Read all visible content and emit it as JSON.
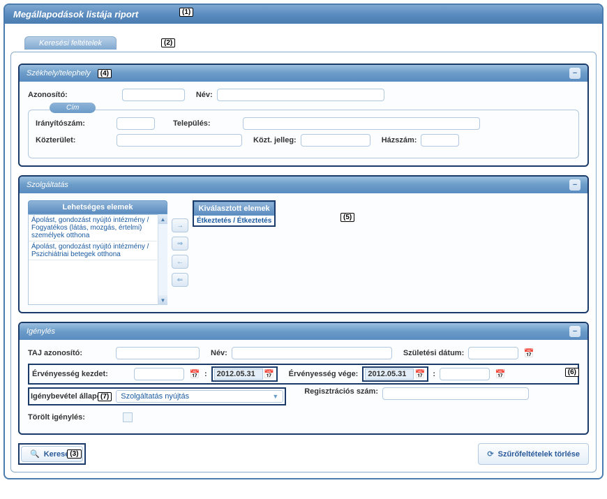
{
  "main": {
    "title": "Megállapodások listája riport",
    "annot": "(1)"
  },
  "tab": {
    "label": "Keresési feltételek",
    "annot": "(2)"
  },
  "section_hq": {
    "title": "Székhely/telephely",
    "annot": "(4)",
    "id_label": "Azonosító:",
    "name_label": "Név:",
    "cim_legend": "Cím",
    "zip_label": "Irányítószám:",
    "city_label": "Település:",
    "street_label": "Közterület:",
    "stype_label": "Közt. jelleg:",
    "houseno_label": "Házszám:"
  },
  "section_service": {
    "title": "Szolgáltatás",
    "available_header": "Lehetséges elemek",
    "selected_header": "Kiválasztott elemek",
    "selected_annot": "(5)",
    "available_items": [
      "Ápolást, gondozást nyújtó intézmény / Fogyatékos (látás, mozgás, értelmi) személyek otthona",
      "Ápolást, gondozást nyújtó intézmény / Pszichiátriai betegek otthona"
    ],
    "selected_items": [
      "Étkeztetés / Étkeztetés"
    ],
    "move_right": "→",
    "move_right_all": "⇒",
    "move_left": "←",
    "move_left_all": "⇐"
  },
  "section_claim": {
    "title": "Igénylés",
    "taj_label": "TAJ azonosító:",
    "name_label": "Név:",
    "birth_label": "Születési dátum:",
    "valid_from_label": "Érvényesség kezdet:",
    "valid_to_label": "Érvényesség vége:",
    "colon": ":",
    "date1": "2012.05.31",
    "date2": "2012.05.31",
    "row_annot": "(6)",
    "status_label": "Igénybevétel állapota:",
    "status_annot": "(7)",
    "status_value": "Szolgáltatás nyújtás",
    "reg_label": "Regisztrációs szám:",
    "deleted_label": "Törölt igénylés:"
  },
  "buttons": {
    "search": "Keresés",
    "search_annot": "(3)",
    "clear": "Szűrőfeltételek törlése"
  }
}
